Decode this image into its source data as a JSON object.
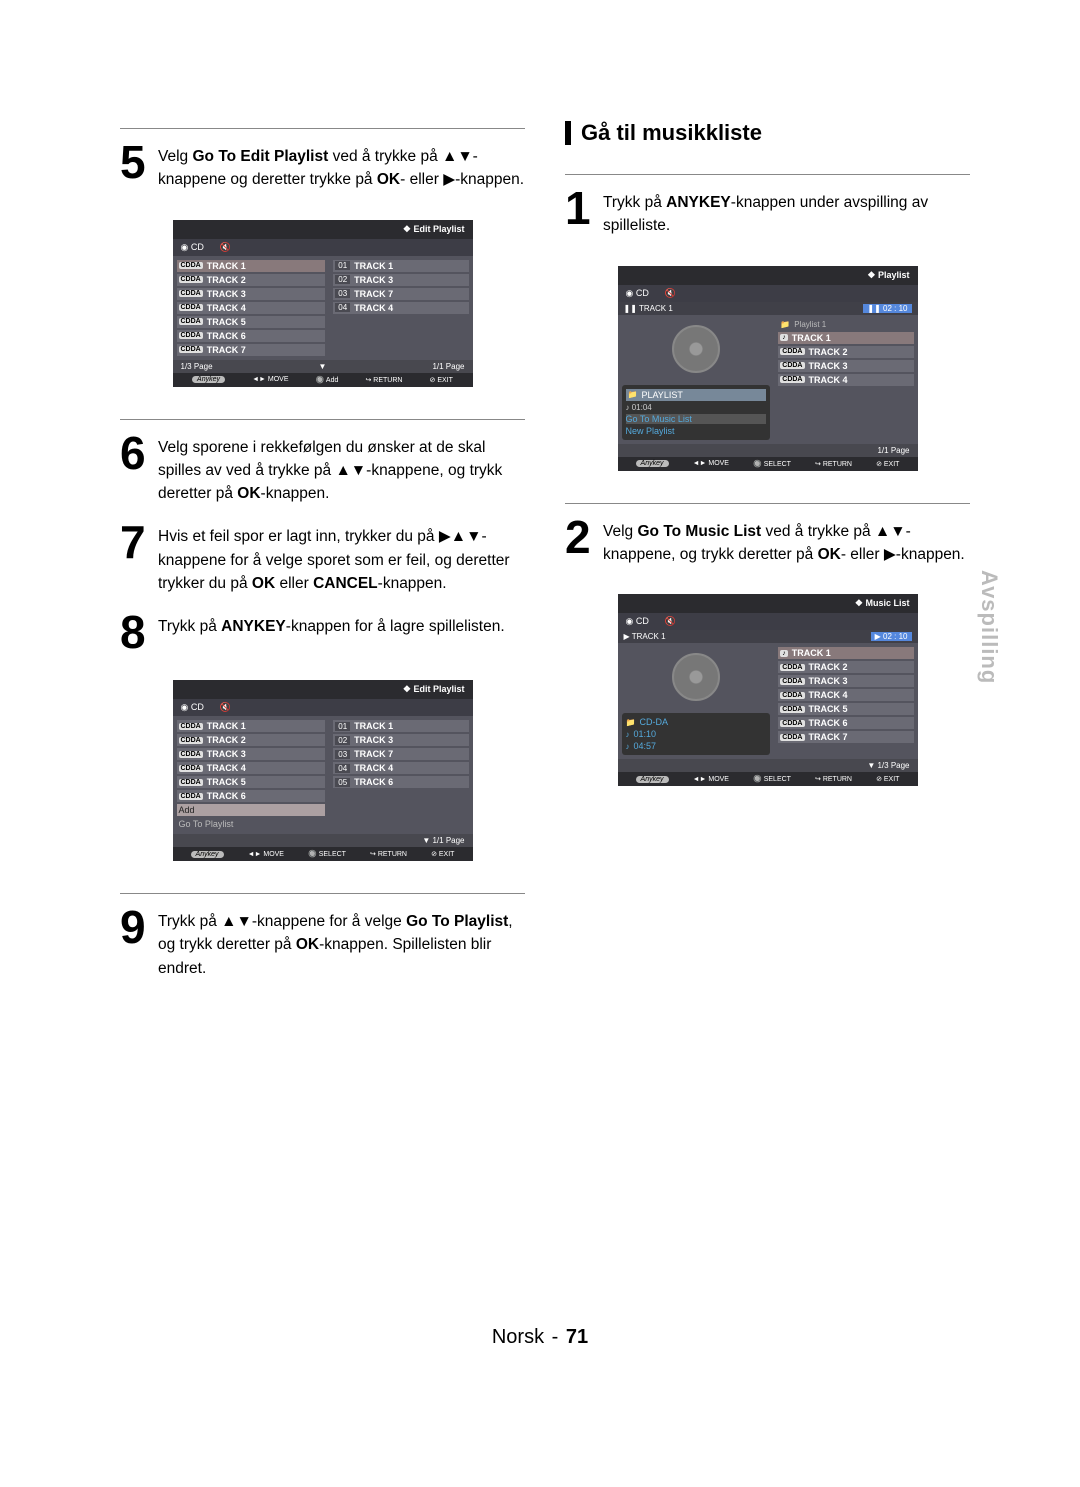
{
  "sideTab": "Avspilling",
  "footer": {
    "lang": "Norsk",
    "page": "71"
  },
  "section2": {
    "title": "Gå til musikkliste"
  },
  "left": {
    "step5": {
      "num": "5",
      "text_parts": [
        "Velg ",
        "Go To Edit Playlist",
        " ved å trykke på ▲▼-knappene og deretter trykke på ",
        "OK",
        "- eller ▶-knappen."
      ]
    },
    "step6": {
      "num": "6",
      "text_parts": [
        "Velg sporene i rekkefølgen du ønsker at de skal spilles av ved å trykke på ▲▼-knappene, og trykk deretter på ",
        "OK",
        "-knappen."
      ]
    },
    "step7": {
      "num": "7",
      "text_parts": [
        "Hvis et feil spor er lagt inn, trykker du på ▶▲▼-knappene for å velge sporet som er feil, og deretter trykker du på ",
        "OK",
        " eller ",
        "CANCEL",
        "-knappen."
      ]
    },
    "step8": {
      "num": "8",
      "text_parts": [
        "Trykk på ",
        "ANYKEY",
        "-knappen for å lagre spillelisten."
      ]
    },
    "step9": {
      "num": "9",
      "text_parts": [
        "Trykk på ▲▼-knappene for å velge ",
        "Go To Playlist",
        ", og trykk deretter på ",
        "OK",
        "-knappen. Spillelisten blir endret."
      ]
    }
  },
  "right": {
    "step1": {
      "num": "1",
      "text_parts": [
        "Trykk på ",
        "ANYKEY",
        "-knappen under avspilling av spilleliste."
      ]
    },
    "step2": {
      "num": "2",
      "text_parts": [
        "Velg ",
        "Go To Music List",
        " ved å trykke på ▲▼-knappene, og trykk deretter på ",
        "OK",
        "- eller ▶-knappen."
      ]
    }
  },
  "screen1": {
    "title": "Edit Playlist",
    "cd": "CD",
    "left_tracks": [
      {
        "cdda": "CDDA",
        "name": "TRACK 1"
      },
      {
        "cdda": "CDDA",
        "name": "TRACK 2"
      },
      {
        "cdda": "CDDA",
        "name": "TRACK 3"
      },
      {
        "cdda": "CDDA",
        "name": "TRACK 4"
      },
      {
        "cdda": "CDDA",
        "name": "TRACK 5"
      },
      {
        "cdda": "CDDA",
        "name": "TRACK 6"
      },
      {
        "cdda": "CDDA",
        "name": "TRACK 7"
      }
    ],
    "right_tracks": [
      {
        "num": "01",
        "name": "TRACK 1"
      },
      {
        "num": "02",
        "name": "TRACK 3"
      },
      {
        "num": "03",
        "name": "TRACK 7"
      },
      {
        "num": "04",
        "name": "TRACK 4"
      }
    ],
    "page_left": "1/3 Page",
    "page_right": "1/1 Page",
    "footer": [
      "Anykey",
      "◄► MOVE",
      "🔘 Add",
      "↪ RETURN",
      "⊘ EXIT"
    ]
  },
  "screen2": {
    "title": "Edit Playlist",
    "cd": "CD",
    "left_tracks": [
      {
        "cdda": "CDDA",
        "name": "TRACK 1"
      },
      {
        "cdda": "CDDA",
        "name": "TRACK 2"
      },
      {
        "cdda": "CDDA",
        "name": "TRACK 3"
      },
      {
        "cdda": "CDDA",
        "name": "TRACK 4"
      },
      {
        "cdda": "CDDA",
        "name": "TRACK 5"
      },
      {
        "cdda": "CDDA",
        "name": "TRACK 6"
      }
    ],
    "menu_items": [
      "Add",
      "Go To Playlist"
    ],
    "right_tracks": [
      {
        "num": "01",
        "name": "TRACK 1"
      },
      {
        "num": "02",
        "name": "TRACK 3"
      },
      {
        "num": "03",
        "name": "TRACK 7"
      },
      {
        "num": "04",
        "name": "TRACK 4"
      },
      {
        "num": "05",
        "name": "TRACK 6"
      }
    ],
    "page_right": "1/1 Page",
    "footer": [
      "Anykey",
      "◄► MOVE",
      "🔘 SELECT",
      "↪ RETURN",
      "⊘ EXIT"
    ]
  },
  "screen3": {
    "title": "Playlist",
    "cd": "CD",
    "header_track": "TRACK 1",
    "header_time": "02 : 10",
    "playlist_label": "Playlist 1",
    "info": [
      {
        "icon": "📁",
        "text": "PLAYLIST",
        "hl": true
      },
      {
        "icon": "",
        "text": "Go To Music List"
      },
      {
        "icon": "",
        "text": "New Playlist"
      }
    ],
    "info_extra": "♪ 01:04",
    "right_tracks": [
      {
        "cdda": "♪",
        "name": "TRACK 1",
        "hl": true
      },
      {
        "cdda": "CDDA",
        "name": "TRACK 2"
      },
      {
        "cdda": "CDDA",
        "name": "TRACK 3"
      },
      {
        "cdda": "CDDA",
        "name": "TRACK 4"
      }
    ],
    "page_right": "1/1 Page",
    "footer": [
      "Anykey",
      "◄► MOVE",
      "🔘 SELECT",
      "↪ RETURN",
      "⊘ EXIT"
    ]
  },
  "screen4": {
    "title": "Music List",
    "cd": "CD",
    "header_track": "TRACK 1",
    "header_time": "02 : 10",
    "info": [
      {
        "icon": "📁",
        "text": "CD-DA"
      },
      {
        "icon": "♪",
        "text": "01:10"
      },
      {
        "icon": "♪",
        "text": "04:57"
      }
    ],
    "right_tracks": [
      {
        "cdda": "♪",
        "name": "TRACK 1",
        "hl": true
      },
      {
        "cdda": "CDDA",
        "name": "TRACK 2"
      },
      {
        "cdda": "CDDA",
        "name": "TRACK 3"
      },
      {
        "cdda": "CDDA",
        "name": "TRACK 4"
      },
      {
        "cdda": "CDDA",
        "name": "TRACK 5"
      },
      {
        "cdda": "CDDA",
        "name": "TRACK 6"
      },
      {
        "cdda": "CDDA",
        "name": "TRACK 7"
      }
    ],
    "page_right": "1/3 Page",
    "footer": [
      "Anykey",
      "◄► MOVE",
      "🔘 SELECT",
      "↪ RETURN",
      "⊘ EXIT"
    ]
  }
}
